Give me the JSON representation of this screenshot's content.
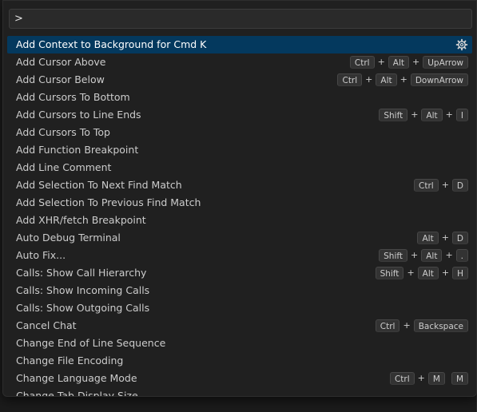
{
  "palette": {
    "input_value": ">",
    "items": [
      {
        "label": "Add Context to Background for Cmd K",
        "selected": true,
        "gear_icon": "gear-icon",
        "keys": []
      },
      {
        "label": "Add Cursor Above",
        "keys": [
          [
            "Ctrl",
            "Alt",
            "UpArrow"
          ]
        ]
      },
      {
        "label": "Add Cursor Below",
        "keys": [
          [
            "Ctrl",
            "Alt",
            "DownArrow"
          ]
        ]
      },
      {
        "label": "Add Cursors To Bottom",
        "keys": []
      },
      {
        "label": "Add Cursors to Line Ends",
        "keys": [
          [
            "Shift",
            "Alt",
            "I"
          ]
        ]
      },
      {
        "label": "Add Cursors To Top",
        "keys": []
      },
      {
        "label": "Add Function Breakpoint",
        "keys": []
      },
      {
        "label": "Add Line Comment",
        "keys": []
      },
      {
        "label": "Add Selection To Next Find Match",
        "keys": [
          [
            "Ctrl",
            "D"
          ]
        ]
      },
      {
        "label": "Add Selection To Previous Find Match",
        "keys": []
      },
      {
        "label": "Add XHR/fetch Breakpoint",
        "keys": []
      },
      {
        "label": "Auto Debug Terminal",
        "keys": [
          [
            "Alt",
            "D"
          ]
        ]
      },
      {
        "label": "Auto Fix...",
        "keys": [
          [
            "Shift",
            "Alt",
            "."
          ]
        ]
      },
      {
        "label": "Calls: Show Call Hierarchy",
        "keys": [
          [
            "Shift",
            "Alt",
            "H"
          ]
        ]
      },
      {
        "label": "Calls: Show Incoming Calls",
        "keys": []
      },
      {
        "label": "Calls: Show Outgoing Calls",
        "keys": []
      },
      {
        "label": "Cancel Chat",
        "keys": [
          [
            "Ctrl",
            "Backspace"
          ]
        ]
      },
      {
        "label": "Change End of Line Sequence",
        "keys": []
      },
      {
        "label": "Change File Encoding",
        "keys": []
      },
      {
        "label": "Change Language Mode",
        "keys": [
          [
            "Ctrl",
            "M"
          ],
          [
            "M"
          ]
        ]
      },
      {
        "label": "Change Tab Display Size",
        "keys": []
      }
    ]
  },
  "colors": {
    "selected_bg": "#04395e",
    "panel_bg": "#202020",
    "text": "#cccccc"
  }
}
